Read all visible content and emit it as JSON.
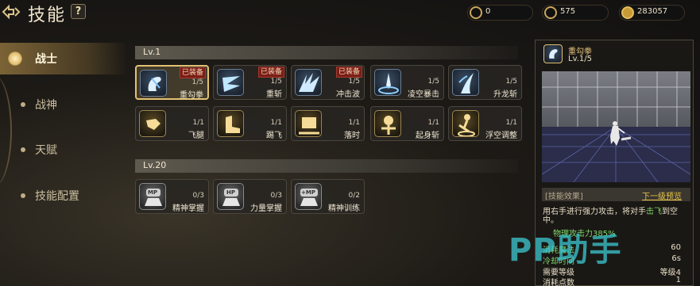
{
  "header": {
    "title": "技能",
    "help_label": "?"
  },
  "currencies": [
    {
      "icon": "gem-coin-icon",
      "value": "0"
    },
    {
      "icon": "moon-coin-icon",
      "value": "575"
    },
    {
      "icon": "gold-coin-icon",
      "value": "283057"
    }
  ],
  "sidebar": {
    "items": [
      {
        "label": "战士",
        "active": true
      },
      {
        "label": "战神",
        "active": false
      },
      {
        "label": "天赋",
        "active": false
      },
      {
        "label": "技能配置",
        "active": false
      }
    ]
  },
  "sections": [
    {
      "level": "Lv.1",
      "rows": [
        [
          {
            "name": "重勾拳",
            "level": "1/5",
            "tag": "已装备",
            "selected": true,
            "icon": "fist-icon"
          },
          {
            "name": "重斩",
            "level": "1/5",
            "tag": "已装备",
            "icon": "slash-icon"
          },
          {
            "name": "冲击波",
            "level": "1/5",
            "tag": "已装备",
            "icon": "shockwave-icon"
          },
          {
            "name": "凌空暴击",
            "level": "1/5",
            "icon": "air-strike-icon"
          },
          {
            "name": "升龙斩",
            "level": "1/5",
            "icon": "rising-slash-icon"
          }
        ],
        [
          {
            "name": "飞腿",
            "level": "1/1",
            "icon": "flying-kick-icon"
          },
          {
            "name": "踢飞",
            "level": "1/1",
            "icon": "kick-icon"
          },
          {
            "name": "落时",
            "level": "1/1",
            "icon": "landing-icon"
          },
          {
            "name": "起身斩",
            "level": "1/1",
            "icon": "rise-slash-icon"
          },
          {
            "name": "浮空调整",
            "level": "1/1",
            "icon": "float-adjust-icon"
          }
        ]
      ]
    },
    {
      "level": "Lv.20",
      "rows": [
        [
          {
            "name": "精神掌握",
            "level": "0/3",
            "icon": "mp-icon",
            "badge": "MP"
          },
          {
            "name": "力量掌握",
            "level": "0/3",
            "icon": "hp-icon",
            "badge": "HP"
          },
          {
            "name": "精神训练",
            "level": "0/2",
            "icon": "mp-plus-icon",
            "badge": "+MP"
          }
        ]
      ]
    }
  ],
  "detail": {
    "name": "重勾拳",
    "level": "Lv.1/5",
    "effect_label": "[技能效果]",
    "next_preview": "下一级预览",
    "desc_pre": "用右手进行强力攻击，将对手",
    "desc_hl": "击飞",
    "desc_post": "到空中。",
    "physical": "物理攻击力385%",
    "stats": [
      {
        "label": "消耗魔法",
        "value": "60",
        "label_color": "#7fd66a"
      },
      {
        "label": "冷却时间",
        "value": "6s",
        "label_color": "#7fd66a"
      },
      {
        "label": "需要等级",
        "value": "等级4",
        "label_color": "#e8dec6"
      },
      {
        "label": "消耗点数",
        "value": "1",
        "label_color": "#e8dec6"
      }
    ]
  },
  "watermark": "PP助手"
}
